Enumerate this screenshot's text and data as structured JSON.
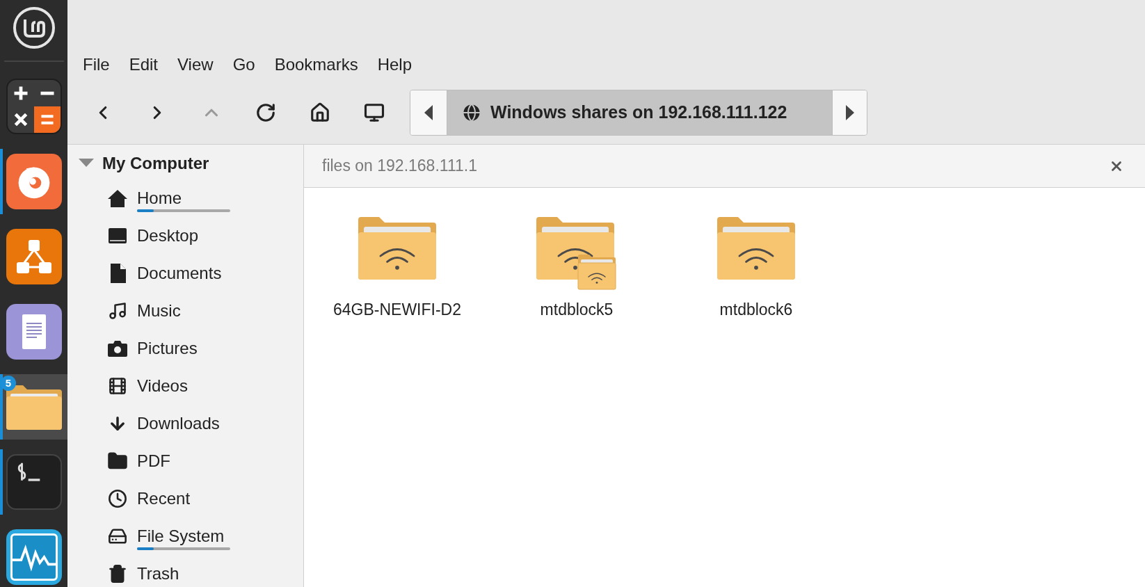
{
  "dock": {
    "apps": [
      {
        "kind": "calculator",
        "running": false,
        "active": false
      },
      {
        "kind": "firefox",
        "running": true,
        "active": false
      },
      {
        "kind": "diagram",
        "running": false,
        "active": false
      },
      {
        "kind": "writer",
        "running": false,
        "active": false
      },
      {
        "kind": "files",
        "running": true,
        "active": true,
        "badge": "5"
      },
      {
        "kind": "terminal",
        "running": true,
        "active": false
      },
      {
        "kind": "monitor",
        "running": false,
        "active": false
      }
    ]
  },
  "menu": [
    "File",
    "Edit",
    "View",
    "Go",
    "Bookmarks",
    "Help"
  ],
  "toolbar": [
    {
      "kind": "back",
      "disabled": false
    },
    {
      "kind": "forward",
      "disabled": false
    },
    {
      "kind": "up",
      "disabled": true
    },
    {
      "kind": "reload",
      "disabled": false
    },
    {
      "kind": "home",
      "disabled": false
    },
    {
      "kind": "computer",
      "disabled": false
    }
  ],
  "location": {
    "path": "Windows shares on 192.168.111.122"
  },
  "sidebar": {
    "section": "My Computer",
    "expanded": true,
    "items": [
      {
        "kind": "home",
        "label": "Home",
        "level": 0.18
      },
      {
        "kind": "desktop",
        "label": "Desktop"
      },
      {
        "kind": "documents",
        "label": "Documents"
      },
      {
        "kind": "music",
        "label": "Music"
      },
      {
        "kind": "pictures",
        "label": "Pictures"
      },
      {
        "kind": "videos",
        "label": "Videos"
      },
      {
        "kind": "downloads",
        "label": "Downloads"
      },
      {
        "kind": "folder",
        "label": "PDF"
      },
      {
        "kind": "recent",
        "label": "Recent"
      },
      {
        "kind": "drive",
        "label": "File System",
        "level": 0.18
      },
      {
        "kind": "trash",
        "label": "Trash"
      }
    ]
  },
  "tab": {
    "title": "files on 192.168.111.1"
  },
  "files": [
    {
      "kind": "share",
      "name": "64GB-NEWIFI-D2"
    },
    {
      "kind": "share-stack",
      "name": "mtdblock5"
    },
    {
      "kind": "share",
      "name": "mtdblock6"
    }
  ]
}
